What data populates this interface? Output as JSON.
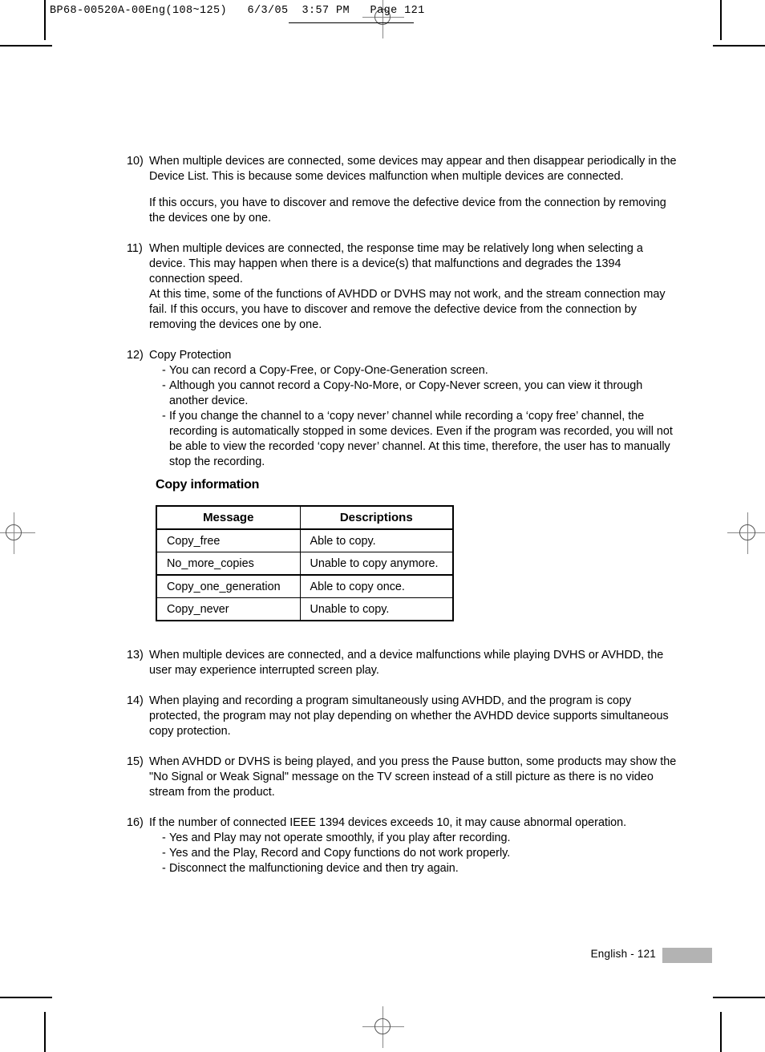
{
  "header": {
    "slug": "BP68-00520A-00Eng(108~125)   6/3/05  3:57 PM   Page 121"
  },
  "content": {
    "items": [
      {
        "number": "10)",
        "paragraphs": [
          "When multiple devices are connected, some devices may appear and then disappear periodically in the Device List. This is because some devices malfunction when multiple devices are connected.",
          "If this occurs, you have to discover and remove the defective device from the connection by removing the devices one by one."
        ]
      },
      {
        "number": "11)",
        "paragraphs": [
          "When multiple devices are connected, the response time may be relatively long when selecting a device. This may happen when there is a device(s) that malfunctions and degrades the 1394 connection speed.",
          "At this time, some of the functions of AVHDD or DVHS may not work, and the stream connection may fail. If this occurs, you have to discover and remove the defective device from the connection by removing the devices one by one."
        ]
      },
      {
        "number": "12)",
        "heading": "Copy Protection",
        "bullets": [
          "You can record a Copy-Free, or Copy-One-Generation screen.",
          "Although you cannot record a Copy-No-More, or Copy-Never screen, you can view it through another device.",
          "If you change the channel to a ‘copy never’ channel while recording a ‘copy free’ channel, the recording is automatically stopped in some devices. Even if the program was recorded, you will not be able to view the recorded ‘copy never’ channel. At this time, therefore, the user has to manually stop the recording."
        ]
      },
      {
        "number": "13)",
        "paragraphs": [
          "When multiple devices are connected, and a device malfunctions while playing DVHS or AVHDD, the user may experience interrupted screen play."
        ]
      },
      {
        "number": "14)",
        "paragraphs": [
          "When playing and recording a program simultaneously using AVHDD, and the program is copy protected, the program may not play depending on whether the AVHDD device supports simultaneous copy protection."
        ]
      },
      {
        "number": "15)",
        "paragraphs": [
          "When AVHDD or DVHS is being played, and you press the Pause button, some products may show the \"No Signal or Weak Signal\" message on the TV screen instead of a still picture as there is no video stream from the product."
        ]
      },
      {
        "number": "16)",
        "heading": "If the number of connected IEEE 1394 devices exceeds 10, it may cause abnormal operation.",
        "bullets": [
          "Yes and Play may not operate smoothly, if you play after recording.",
          "Yes and the Play, Record and Copy functions do not work properly.",
          "Disconnect the malfunctioning device and then try again."
        ]
      }
    ]
  },
  "copy_information": {
    "heading": "Copy information",
    "columns": [
      "Message",
      "Descriptions"
    ],
    "rows": [
      {
        "message": "Copy_free",
        "description": "Able to copy."
      },
      {
        "message": "No_more_copies",
        "description": "Unable to copy anymore."
      },
      {
        "message": "Copy_one_generation",
        "description": "Able to copy once."
      },
      {
        "message": "Copy_never",
        "description": "Unable to copy."
      }
    ]
  },
  "footer": {
    "page_label": "English - 121",
    "tab_color": "#b3b3b3"
  },
  "dash": "-"
}
